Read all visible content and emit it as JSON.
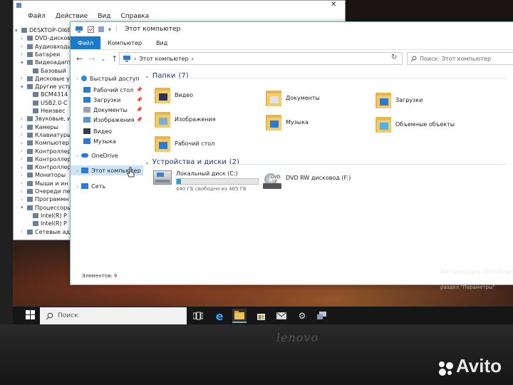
{
  "device_manager": {
    "menu": [
      "Файл",
      "Действие",
      "Вид",
      "Справка"
    ],
    "tree": [
      {
        "label": "DESKTOP-OI6EN",
        "arrow": "▾",
        "indent": 0
      },
      {
        "label": "DVD-дисковод",
        "arrow": "›",
        "indent": 1
      },
      {
        "label": "Аудиовходы",
        "arrow": "›",
        "indent": 1
      },
      {
        "label": "Батареи",
        "arrow": "›",
        "indent": 1
      },
      {
        "label": "Видеоадапте",
        "arrow": "▾",
        "indent": 1
      },
      {
        "label": "Базовый",
        "arrow": "",
        "indent": 2
      },
      {
        "label": "Дисковые у",
        "arrow": "›",
        "indent": 1
      },
      {
        "label": "Другие устр",
        "arrow": "▾",
        "indent": 1
      },
      {
        "label": "BCM4314",
        "arrow": "",
        "indent": 2
      },
      {
        "label": "USB2.0-C",
        "arrow": "",
        "indent": 2
      },
      {
        "label": "Неизвес",
        "arrow": "",
        "indent": 2
      },
      {
        "label": "Звуковые, и",
        "arrow": "›",
        "indent": 1
      },
      {
        "label": "Камеры",
        "arrow": "›",
        "indent": 1
      },
      {
        "label": "Клавиатуры",
        "arrow": "›",
        "indent": 1
      },
      {
        "label": "Компьютер",
        "arrow": "›",
        "indent": 1
      },
      {
        "label": "Контроллер",
        "arrow": "›",
        "indent": 1
      },
      {
        "label": "Контроллер",
        "arrow": "›",
        "indent": 1
      },
      {
        "label": "Контроллер",
        "arrow": "›",
        "indent": 1
      },
      {
        "label": "Мониторы",
        "arrow": "›",
        "indent": 1
      },
      {
        "label": "Мыши и ин",
        "arrow": "›",
        "indent": 1
      },
      {
        "label": "Очереди пе",
        "arrow": "›",
        "indent": 1
      },
      {
        "label": "Программн",
        "arrow": "›",
        "indent": 1
      },
      {
        "label": "Процессоры",
        "arrow": "▾",
        "indent": 1
      },
      {
        "label": "Intel(R) P",
        "arrow": "",
        "indent": 2
      },
      {
        "label": "Intel(R) P",
        "arrow": "",
        "indent": 2
      },
      {
        "label": "Сетевые адап",
        "arrow": "›",
        "indent": 1
      }
    ]
  },
  "explorer": {
    "title": "Этот компьютер",
    "tabs": [
      "Файл",
      "Компьютер",
      "Вид"
    ],
    "address_path": "Этот компьютер",
    "address_sep": "›",
    "search_placeholder": "Поиск: Этот компьютер",
    "nav": [
      {
        "label": "Быстрый доступ",
        "icon": "star-icon",
        "color": "#2a8ad8",
        "pin": false,
        "indent": 0
      },
      {
        "label": "Рабочий стол",
        "icon": "desktop-icon",
        "color": "#2a7ad6",
        "pin": true,
        "indent": 1
      },
      {
        "label": "Загрузки",
        "icon": "downloads-icon",
        "color": "#2a7ad6",
        "pin": true,
        "indent": 1
      },
      {
        "label": "Документы",
        "icon": "documents-icon",
        "color": "#9aa4b2",
        "pin": true,
        "indent": 1
      },
      {
        "label": "Изображения",
        "icon": "pictures-icon",
        "color": "#5a96c8",
        "pin": true,
        "indent": 1
      },
      {
        "label": "Видео",
        "icon": "video-icon",
        "color": "#333c4a",
        "pin": false,
        "indent": 1
      },
      {
        "label": "Музыка",
        "icon": "music-icon",
        "color": "#2a7ad6",
        "pin": false,
        "indent": 1
      },
      {
        "label": "OneDrive",
        "icon": "onedrive-icon",
        "color": "#2a7ad6",
        "pin": false,
        "indent": 0
      },
      {
        "label": "Этот компьютер",
        "icon": "computer-icon",
        "color": "#2a7ad6",
        "pin": false,
        "indent": 0,
        "selected": true
      },
      {
        "label": "Сеть",
        "icon": "network-icon",
        "color": "#2a7ad6",
        "pin": false,
        "indent": 0
      }
    ],
    "folders_header": "Папки",
    "folders_count": "(7)",
    "folders": [
      {
        "label": "Видео",
        "icon": "video-folder-icon"
      },
      {
        "label": "Документы",
        "icon": "documents-folder-icon"
      },
      {
        "label": "Загрузки",
        "icon": "downloads-folder-icon"
      },
      {
        "label": "Изображения",
        "icon": "pictures-folder-icon"
      },
      {
        "label": "Музыка",
        "icon": "music-folder-icon"
      },
      {
        "label": "Объемные объекты",
        "icon": "3d-objects-folder-icon"
      },
      {
        "label": "Рабочий стол",
        "icon": "desktop-folder-icon"
      }
    ],
    "devices_header": "Устройства и диски",
    "devices_count": "(2)",
    "local_disk": {
      "label": "Локальный диск (C:)",
      "free_text": "440 ГБ свободно из 465 ГБ",
      "used_fraction": 0.054
    },
    "dvd_drive": {
      "label": "DVD RW дисковод (F:)",
      "badge": "DVD"
    },
    "status": "Элементов: 9"
  },
  "activation": {
    "line1": "Активация Windows",
    "line2": "раздел \"Параметры\""
  },
  "taskbar": {
    "search_placeholder": "Поиск"
  },
  "overlay": {
    "laptop_brand": "lenovo",
    "watermark": "Avito"
  }
}
